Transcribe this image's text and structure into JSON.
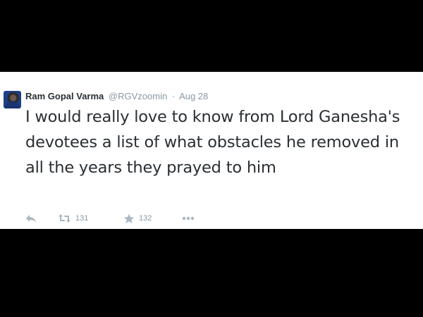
{
  "tweet": {
    "author_name": "Ram Gopal Varma",
    "author_handle": "@RGVzoomin",
    "separator": "·",
    "timestamp": "Aug 28",
    "text": "I would really love to know from Lord Ganesha's devotees a list of what obstacles he removed in all the years they prayed to him",
    "retweet_count": "131",
    "favorite_count": "132"
  },
  "icons": {
    "reply": "reply-icon",
    "retweet": "retweet-icon",
    "favorite": "star-icon",
    "more": "more-dots-icon"
  },
  "colors": {
    "background_bars": "#000000",
    "card": "#ffffff",
    "text": "#292f33",
    "muted": "#8899a6",
    "icon": "#aab8c2"
  }
}
